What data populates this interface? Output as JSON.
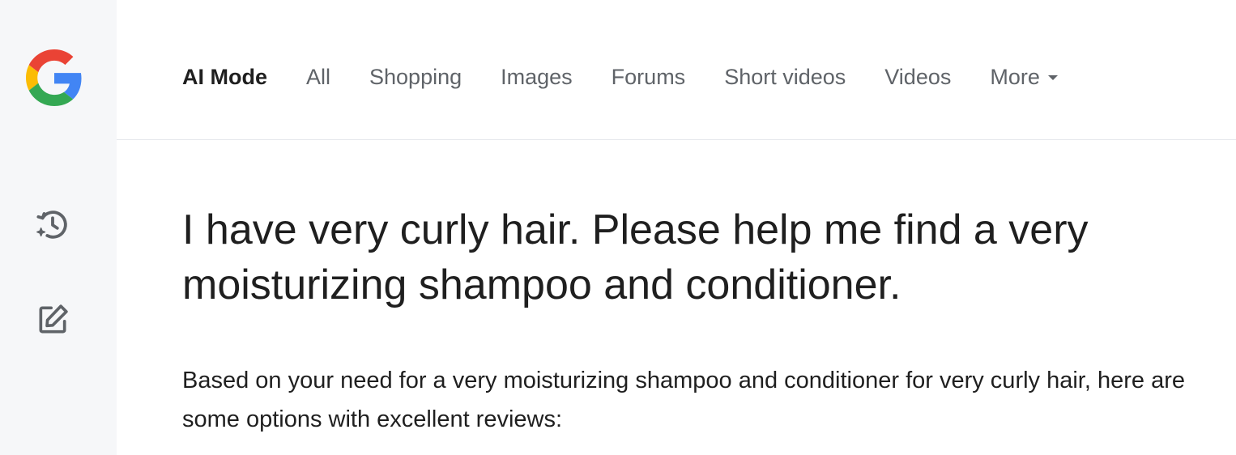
{
  "sidebar": {
    "logo_icon": "google-g-logo",
    "items": [
      {
        "icon": "history-sparkle-icon"
      },
      {
        "icon": "edit-square-icon"
      }
    ]
  },
  "tabs": [
    {
      "label": "AI Mode",
      "active": true
    },
    {
      "label": "All"
    },
    {
      "label": "Shopping"
    },
    {
      "label": "Images"
    },
    {
      "label": "Forums"
    },
    {
      "label": "Short videos"
    },
    {
      "label": "Videos"
    },
    {
      "label": "More",
      "icon": "dropdown-caret-icon"
    }
  ],
  "query": "I have very curly hair. Please help me find a very moisturizing shampoo and conditioner.",
  "answer": "Based on your need for a very moisturizing shampoo and conditioner for very curly hair, here are some options with excellent reviews:",
  "colors": {
    "sidebar_bg": "#f6f7f9",
    "tab_inactive": "#5f6368",
    "text": "#1f1f1f",
    "google_blue": "#4285F4",
    "google_red": "#EA4335",
    "google_yellow": "#FBBC05",
    "google_green": "#34A853"
  }
}
